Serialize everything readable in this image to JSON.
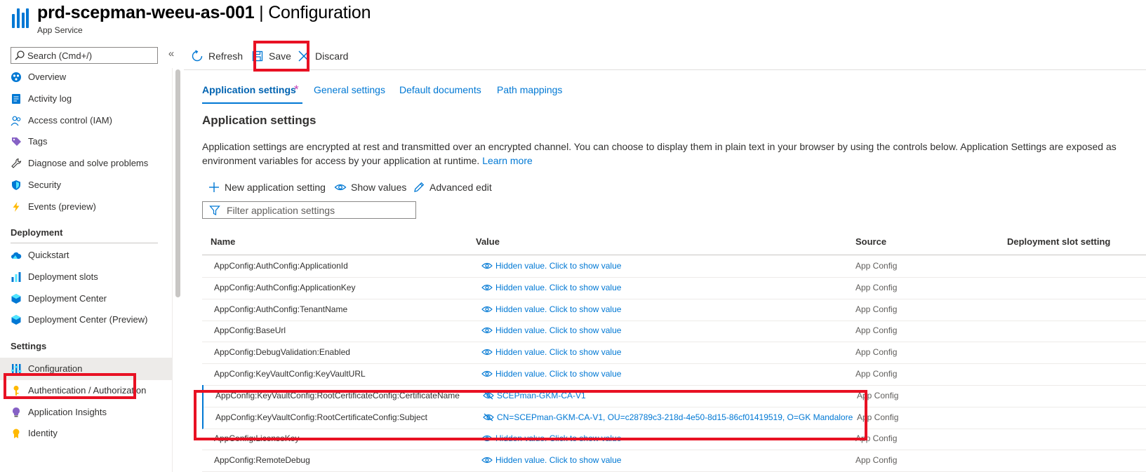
{
  "header": {
    "resource_name": "prd-scepman-weeu-as-001",
    "separator": " | ",
    "page_name": "Configuration",
    "resource_type": "App Service"
  },
  "sidebar": {
    "search_placeholder": "Search (Cmd+/)",
    "collapse_glyph": "«",
    "items_top": [
      {
        "label": "Overview",
        "icon": "overview-icon"
      },
      {
        "label": "Activity log",
        "icon": "activity-log-icon"
      },
      {
        "label": "Access control (IAM)",
        "icon": "iam-icon"
      },
      {
        "label": "Tags",
        "icon": "tag-icon"
      },
      {
        "label": "Diagnose and solve problems",
        "icon": "wrench-icon"
      },
      {
        "label": "Security",
        "icon": "shield-icon"
      },
      {
        "label": "Events (preview)",
        "icon": "lightning-icon"
      }
    ],
    "deployment_heading": "Deployment",
    "items_deployment": [
      {
        "label": "Quickstart",
        "icon": "cloud-icon"
      },
      {
        "label": "Deployment slots",
        "icon": "slots-icon"
      },
      {
        "label": "Deployment Center",
        "icon": "cube-icon"
      },
      {
        "label": "Deployment Center (Preview)",
        "icon": "cube-icon"
      }
    ],
    "settings_heading": "Settings",
    "items_settings": [
      {
        "label": "Configuration",
        "icon": "configuration-icon",
        "selected": true
      },
      {
        "label": "Authentication / Authorization",
        "icon": "key-icon"
      },
      {
        "label": "Application Insights",
        "icon": "bulb-icon"
      },
      {
        "label": "Identity",
        "icon": "identity-icon"
      }
    ]
  },
  "toolbar": {
    "refresh_label": "Refresh",
    "save_label": "Save",
    "discard_label": "Discard"
  },
  "tabs": [
    {
      "label": "Application settings",
      "active": true,
      "modified_marker": "*"
    },
    {
      "label": "General settings"
    },
    {
      "label": "Default documents"
    },
    {
      "label": "Path mappings"
    }
  ],
  "section": {
    "title": "Application settings",
    "description": "Application settings are encrypted at rest and transmitted over an encrypted channel. You can choose to display them in plain text in your browser by using the controls below. Application Settings are exposed as environment variables for access by your application at runtime.",
    "learn_more": "Learn more"
  },
  "commands": {
    "new_setting": "New application setting",
    "show_values": "Show values",
    "advanced_edit": "Advanced edit",
    "filter_placeholder": "Filter application settings"
  },
  "grid": {
    "columns": [
      "Name",
      "Value",
      "Source",
      "Deployment slot setting"
    ],
    "rows": [
      {
        "name": "AppConfig:AuthConfig:ApplicationId",
        "value": "Hidden value. Click to show value",
        "source": "App Config",
        "hidden": true
      },
      {
        "name": "AppConfig:AuthConfig:ApplicationKey",
        "value": "Hidden value. Click to show value",
        "source": "App Config",
        "hidden": true
      },
      {
        "name": "AppConfig:AuthConfig:TenantName",
        "value": "Hidden value. Click to show value",
        "source": "App Config",
        "hidden": true
      },
      {
        "name": "AppConfig:BaseUrl",
        "value": "Hidden value. Click to show value",
        "source": "App Config",
        "hidden": true
      },
      {
        "name": "AppConfig:DebugValidation:Enabled",
        "value": "Hidden value. Click to show value",
        "source": "App Config",
        "hidden": true
      },
      {
        "name": "AppConfig:KeyVaultConfig:KeyVaultURL",
        "value": "Hidden value. Click to show value",
        "source": "App Config",
        "hidden": true
      },
      {
        "name": "AppConfig:KeyVaultConfig:RootCertificateConfig:CertificateName",
        "value": "SCEPman-GKM-CA-V1",
        "source": "App Config",
        "hidden": false,
        "modified": true
      },
      {
        "name": "AppConfig:KeyVaultConfig:RootCertificateConfig:Subject",
        "value": "CN=SCEPman-GKM-CA-V1, OU=c28789c3-218d-4e50-8d15-86cf01419519, O=GK Mandalore",
        "source": "App Config",
        "hidden": false,
        "modified": true
      },
      {
        "name": "AppConfig:LicenseKey",
        "value": "Hidden value. Click to show value",
        "source": "App Config",
        "hidden": true
      },
      {
        "name": "AppConfig:RemoteDebug",
        "value": "Hidden value. Click to show value",
        "source": "App Config",
        "hidden": true
      }
    ]
  },
  "colors": {
    "accent": "#0078d4",
    "highlight": "#e81123",
    "modified_marker": "#c239b3"
  }
}
